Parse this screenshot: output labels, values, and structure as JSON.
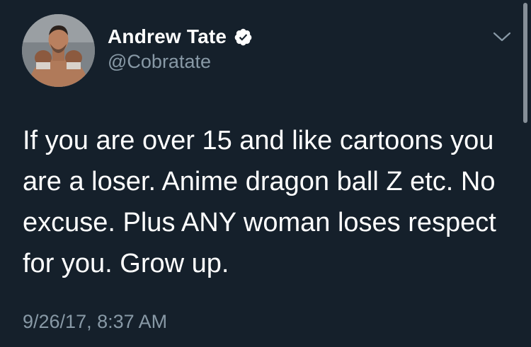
{
  "author": {
    "display_name": "Andrew Tate",
    "handle": "@Cobratate",
    "verified": true,
    "avatar_icon": "profile-photo-boxer"
  },
  "tweet": {
    "text": "If you are over 15 and like cartoons you are a loser. Anime dragon ball Z etc. No excuse. Plus ANY woman loses respect for you. Grow up.",
    "timestamp": "9/26/17, 8:37 AM"
  },
  "icons": {
    "verified": "verified-badge-icon",
    "menu": "chevron-down-icon"
  },
  "colors": {
    "background": "#15202b",
    "primary_text": "#ffffff",
    "secondary_text": "#8899a6",
    "verified_badge": "#ffffff"
  }
}
